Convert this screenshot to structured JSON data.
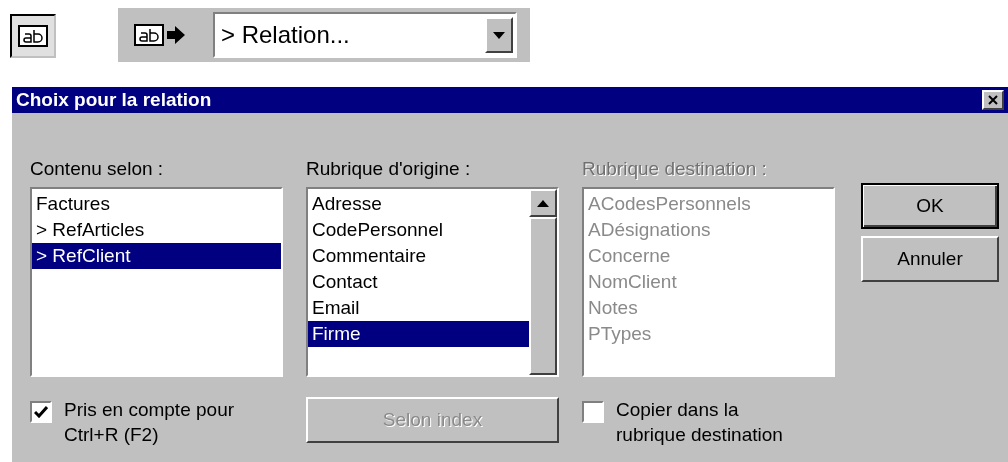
{
  "toolbar": {
    "dropdown": {
      "value": "> Relation..."
    }
  },
  "dialog": {
    "title": "Choix pour la relation",
    "lists": [
      {
        "label": "Contenu selon :",
        "disabled": false,
        "scrollbar": false,
        "items": [
          {
            "text": "Factures",
            "selected": false
          },
          {
            "text": "> RefArticles",
            "selected": false
          },
          {
            "text": "> RefClient",
            "selected": true
          }
        ]
      },
      {
        "label": "Rubrique d'origine :",
        "disabled": false,
        "scrollbar": true,
        "items": [
          {
            "text": "Adresse",
            "selected": false
          },
          {
            "text": "CodePersonnel",
            "selected": false
          },
          {
            "text": "Commentaire",
            "selected": false
          },
          {
            "text": "Contact",
            "selected": false
          },
          {
            "text": "Email",
            "selected": false
          },
          {
            "text": "Firme",
            "selected": true
          }
        ]
      },
      {
        "label": "Rubrique destination :",
        "disabled": true,
        "scrollbar": false,
        "items": [
          {
            "text": "ACodesPersonnels",
            "selected": false
          },
          {
            "text": "ADésignations",
            "selected": false
          },
          {
            "text": "Concerne",
            "selected": false
          },
          {
            "text": "NomClient",
            "selected": false
          },
          {
            "text": "Notes",
            "selected": false
          },
          {
            "text": "PTypes",
            "selected": false
          }
        ]
      }
    ],
    "buttons": [
      {
        "label": "OK",
        "default": true
      },
      {
        "label": "Annuler",
        "default": false
      }
    ],
    "options": [
      {
        "kind": "checkbox",
        "lines": [
          "Pris en compte pour",
          "Ctrl+R (F2)"
        ],
        "checked": true
      },
      {
        "kind": "button",
        "label": "Selon index",
        "disabled": true
      },
      {
        "kind": "checkbox",
        "lines": [
          "Copier dans la",
          "rubrique destination"
        ],
        "checked": false
      }
    ]
  }
}
